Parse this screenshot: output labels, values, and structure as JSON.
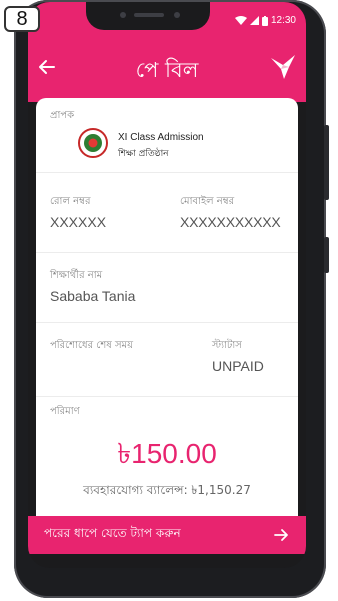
{
  "step_badge": "8",
  "status_bar": {
    "time": "12:30"
  },
  "header": {
    "title": "পে বিল"
  },
  "receiver": {
    "label": "প্রাপক",
    "name": "XI Class Admission",
    "subtitle": "শিক্ষা প্রতিষ্ঠান"
  },
  "roll": {
    "label": "রোল নম্বর",
    "value": "XXXXXX"
  },
  "mobile": {
    "label": "মোবাইল নম্বর",
    "value": "XXXXXXXXXXX"
  },
  "student": {
    "label": "শিক্ষার্থীর নাম",
    "value": "Sababa Tania"
  },
  "deadline": {
    "label": "পরিশোধের শেষ সময়"
  },
  "status": {
    "label": "স্ট্যাটাস",
    "value": "UNPAID"
  },
  "amount": {
    "label": "পরিমাণ",
    "value": "৳150.00"
  },
  "balance": {
    "text": "ব্যবহারযোগ্য ব্যালেন্স: ৳1,150.27"
  },
  "cta": {
    "label": "পরের ধাপে যেতে ট্যাপ করুন"
  },
  "colors": {
    "accent": "#e8246f",
    "phone_frame": "#1c1d20"
  },
  "icons": [
    "back-arrow-icon",
    "bird-logo-icon",
    "institution-seal-icon",
    "forward-arrow-icon",
    "wifi-icon",
    "signal-icon",
    "battery-icon"
  ]
}
